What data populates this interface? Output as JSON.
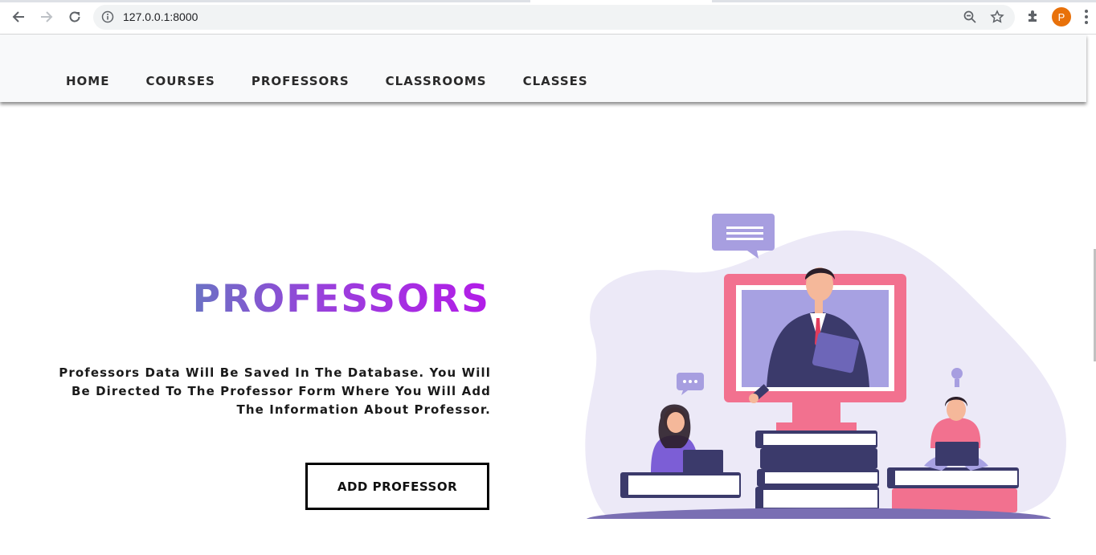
{
  "browser": {
    "url": "127.0.0.1:8000",
    "profile_initial": "P",
    "icons": [
      "back-icon",
      "forward-icon",
      "reload-icon",
      "info-icon",
      "zoom-icon",
      "bookmark-star-icon",
      "extensions-icon",
      "menu-icon"
    ]
  },
  "nav": {
    "items": [
      "HOME",
      "COURSES",
      "PROFESSORS",
      "CLASSROOMS",
      "CLASSES"
    ]
  },
  "hero": {
    "title": "PROFESSORS",
    "description": "Professors Data Will Be Saved In The Database. You Will Be Directed To The Professor Form Where You Will Add The Information About Professor.",
    "button_label": "ADD PROFESSOR"
  },
  "colors": {
    "title_gradient_start": "#6b72c4",
    "title_gradient_end": "#b31ce8",
    "header_bg": "#f8f9fa",
    "illustration_blob": "#ece9f7",
    "monitor": "#f2718f",
    "books_dark": "#3b3a6b"
  }
}
